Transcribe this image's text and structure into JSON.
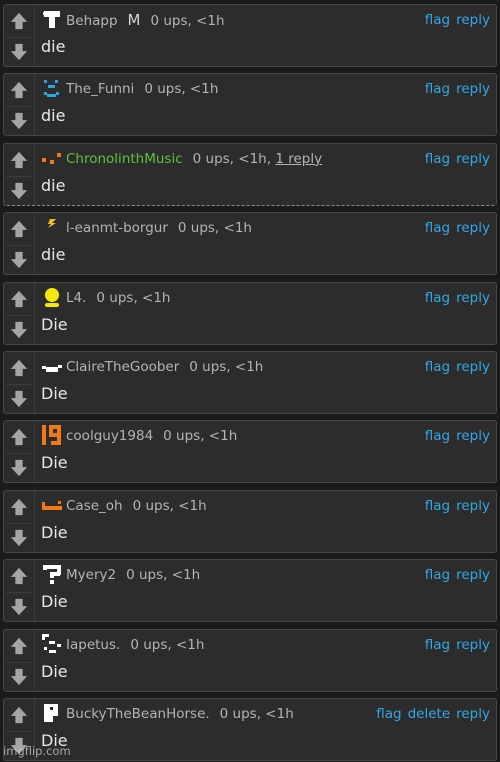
{
  "comments": [
    {
      "avatar": "behapp-avatar-icon",
      "user": "Behapp",
      "extra": "M",
      "ups": "0 ups, <1h",
      "replies": "",
      "text": "die",
      "actions": [
        "flag",
        "reply"
      ]
    },
    {
      "avatar": "the-funni-avatar-icon",
      "user": "The_Funni",
      "extra": "",
      "ups": "0 ups, <1h",
      "replies": "",
      "text": "die",
      "actions": [
        "flag",
        "reply"
      ]
    },
    {
      "avatar": "chronolinth-avatar-icon",
      "user": "ChronolinthMusic",
      "extra": "",
      "ups": "0 ups, <1h,",
      "replies": "1 reply",
      "text": "die",
      "actions": [
        "flag",
        "reply"
      ]
    },
    {
      "avatar": "lightning-avatar-icon",
      "user": "l-eanmt-borgur",
      "extra": "",
      "ups": "0 ups, <1h",
      "replies": "",
      "text": "die",
      "actions": [
        "flag",
        "reply"
      ]
    },
    {
      "avatar": "yellow-person-avatar-icon",
      "user": "L4.",
      "extra": "",
      "ups": "0 ups, <1h",
      "replies": "",
      "text": "Die",
      "actions": [
        "flag",
        "reply"
      ]
    },
    {
      "avatar": "claire-avatar-icon",
      "user": "ClaireTheGoober",
      "extra": "",
      "ups": "0 ups, <1h",
      "replies": "",
      "text": "Die",
      "actions": [
        "flag",
        "reply"
      ]
    },
    {
      "avatar": "nineteen-avatar-icon",
      "user": "coolguy1984",
      "extra": "",
      "ups": "0 ups, <1h",
      "replies": "",
      "text": "Die",
      "actions": [
        "flag",
        "reply"
      ]
    },
    {
      "avatar": "case-oh-avatar-icon",
      "user": "Case_oh",
      "extra": "",
      "ups": "0 ups, <1h",
      "replies": "",
      "text": "Die",
      "actions": [
        "flag",
        "reply"
      ]
    },
    {
      "avatar": "question-avatar-icon",
      "user": "Myery2",
      "extra": "",
      "ups": "0 ups, <1h",
      "replies": "",
      "text": "Die",
      "actions": [
        "flag",
        "reply"
      ]
    },
    {
      "avatar": "iapetus-avatar-icon",
      "user": "Iapetus.",
      "extra": "",
      "ups": "0 ups, <1h",
      "replies": "",
      "text": "Die",
      "actions": [
        "flag",
        "reply"
      ]
    },
    {
      "avatar": "bucky-avatar-icon",
      "user": "BuckyTheBeanHorse.",
      "extra": "",
      "ups": "0 ups, <1h",
      "replies": "",
      "text": "Die",
      "actions": [
        "flag",
        "delete",
        "reply"
      ]
    }
  ],
  "icons": {
    "upvote": "up-arrow-icon",
    "downvote": "down-arrow-icon"
  },
  "colors": {
    "link": "#30a8e8",
    "username_highlight": "#5fc03a",
    "card": "#2c2c2c",
    "background": "#1b1b1b"
  },
  "watermark": "imgflip.com"
}
